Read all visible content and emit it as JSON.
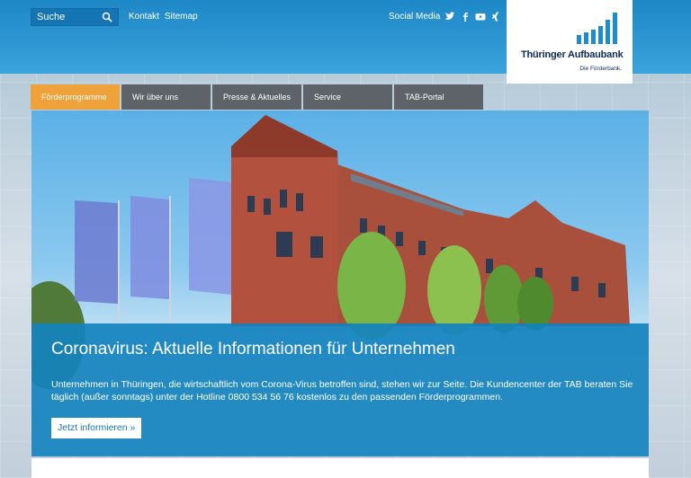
{
  "search": {
    "label": "Suche",
    "icon": "search-icon"
  },
  "toplinks": [
    {
      "label": "Kontakt"
    },
    {
      "label": "Sitemap"
    }
  ],
  "social": {
    "label": "Social Media",
    "icons": [
      "twitter-icon",
      "facebook-icon",
      "youtube-icon",
      "xing-icon",
      "linkedin-icon"
    ]
  },
  "logo": {
    "name": "Thüringer Aufbaubank",
    "tagline": "Die Förderbank."
  },
  "nav": [
    {
      "label": "Förderprogramme",
      "active": true
    },
    {
      "label": "Wir über uns",
      "active": false
    },
    {
      "label": "Presse & Aktuelles",
      "active": false
    },
    {
      "label": "Service",
      "active": false
    },
    {
      "label": "TAB-Portal",
      "active": false
    }
  ],
  "hero": {
    "title": "Coronavirus: Aktuelle Informationen für Unternehmen",
    "text": "Unternehmen in Thüringen, die wirtschaftlich vom Corona-Virus betroffen sind, stehen wir zur Seite. Die Kundencenter der TAB beraten Sie täglich (außer sonntags) unter der Hotline 0800 534 56 76 kostenlos zu den passenden Förderprogrammen.",
    "cta": "Jetzt informieren »"
  },
  "colors": {
    "brand_blue": "#1b8ccd",
    "nav_active": "#f0a23a",
    "nav_inactive": "#5d6368",
    "logo_navy": "#0e2a57"
  }
}
